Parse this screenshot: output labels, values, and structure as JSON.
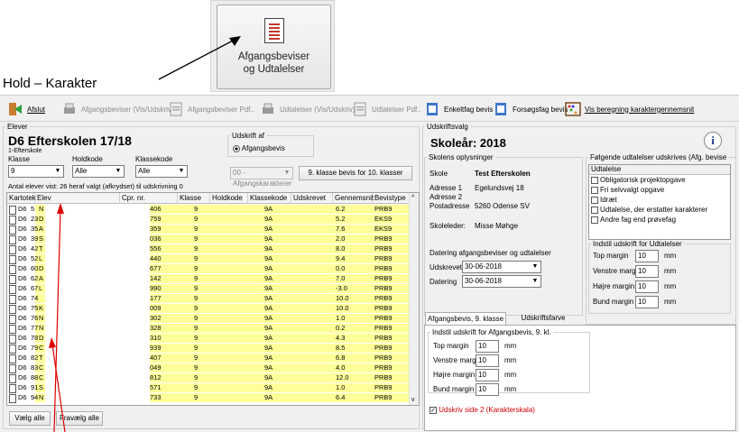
{
  "callout": {
    "button_line1": "Afgangsbeviser",
    "button_line2": "og Udtalelser"
  },
  "page_label": "Hold – Karakter",
  "toolbar": {
    "afslut": "Afslut",
    "afgangsbeviser_vis": "Afgangsbeviser (Vis/Udskriv)",
    "afgangsbeviser_pdf": "Afgangsbeviser Pdf..",
    "udtalelser_vis": "Udtalelser (Vis/Udskriv)",
    "udtalelser_pdf": "Udtalelser Pdf..",
    "enkeltfag": "Enkeltfag bevis",
    "fagsfag": "Forsøgsfag bevis",
    "vis_beregning": "Vis beregning karaktergennemsnit"
  },
  "elever": {
    "group_label": "Elever",
    "school_title": "D6 Efterskolen 17/18",
    "school_sub": "1-Efterskole",
    "klasse_label": "Klasse",
    "klasse_value": "9",
    "holdkode_label": "Holdkode",
    "holdkode_value": "Alle",
    "klassekode_label": "Klassekode",
    "klassekode_value": "Alle",
    "udskrift_af_label": "Udskrift af",
    "udskrift_af_option": "Afgangsbevis",
    "karakterer_combo": "00 - Afgangskarakterer",
    "button_9_klasse": "9. klasse bevis for 10. klasser",
    "antal_text": "Antal elever vist: 26 heraf valgt (afkrydset) til udskrivning 0",
    "columns": [
      "Kartotek",
      "Elev",
      "Cpr. nr.",
      "Klasse",
      "Holdkode",
      "Klassekode",
      "Udskrevet",
      "Gennemsnit",
      "Bevistype"
    ],
    "rows": [
      {
        "k1": "D6",
        "k2": "5",
        "e": "N",
        "cpr": "406",
        "kl": "9",
        "kk": "9A",
        "g": "6.2",
        "b": "PRB9"
      },
      {
        "k1": "D6",
        "k2": "23",
        "e": "D",
        "cpr": "759",
        "kl": "9",
        "kk": "9A",
        "g": "5.2",
        "b": "EKS9"
      },
      {
        "k1": "D6",
        "k2": "35",
        "e": "A",
        "cpr": "359",
        "kl": "9",
        "kk": "9A",
        "g": "7.6",
        "b": "EKS9"
      },
      {
        "k1": "D6",
        "k2": "39",
        "e": "S",
        "cpr": "036",
        "kl": "9",
        "kk": "9A",
        "g": "2.0",
        "b": "PRB9"
      },
      {
        "k1": "D6",
        "k2": "42",
        "e": "T",
        "cpr": "556",
        "kl": "9",
        "kk": "9A",
        "g": "8.0",
        "b": "PRB9"
      },
      {
        "k1": "D6",
        "k2": "52",
        "e": "L",
        "cpr": "440",
        "kl": "9",
        "kk": "9A",
        "g": "9.4",
        "b": "PRB9"
      },
      {
        "k1": "D6",
        "k2": "60",
        "e": "D",
        "cpr": "677",
        "kl": "9",
        "kk": "9A",
        "g": "0.0",
        "b": "PRB9"
      },
      {
        "k1": "D6",
        "k2": "62",
        "e": "A",
        "cpr": "142",
        "kl": "9",
        "kk": "9A",
        "g": "7.0",
        "b": "PRB9"
      },
      {
        "k1": "D6",
        "k2": "67",
        "e": "L",
        "cpr": "990",
        "kl": "9",
        "kk": "9A",
        "g": "-3.0",
        "b": "PRB9"
      },
      {
        "k1": "D6",
        "k2": "74",
        "e": "",
        "cpr": "177",
        "kl": "9",
        "kk": "9A",
        "g": "10.0",
        "b": "PRB9"
      },
      {
        "k1": "D6",
        "k2": "75",
        "e": "K",
        "cpr": "009",
        "kl": "9",
        "kk": "9A",
        "g": "10.0",
        "b": "PRB9"
      },
      {
        "k1": "D6",
        "k2": "76",
        "e": "N",
        "cpr": "302",
        "kl": "9",
        "kk": "9A",
        "g": "1.0",
        "b": "PRB9"
      },
      {
        "k1": "D6",
        "k2": "77",
        "e": "N",
        "cpr": "328",
        "kl": "9",
        "kk": "9A",
        "g": "0.2",
        "b": "PRB9"
      },
      {
        "k1": "D6",
        "k2": "78",
        "e": "D",
        "cpr": "310",
        "kl": "9",
        "kk": "9A",
        "g": "4.3",
        "b": "PRB9"
      },
      {
        "k1": "D6",
        "k2": "79",
        "e": "C",
        "cpr": "939",
        "kl": "9",
        "kk": "9A",
        "g": "8.5",
        "b": "PRB9"
      },
      {
        "k1": "D6",
        "k2": "82",
        "e": "T",
        "cpr": "407",
        "kl": "9",
        "kk": "9A",
        "g": "6.8",
        "b": "PRB9"
      },
      {
        "k1": "D6",
        "k2": "83",
        "e": "C",
        "cpr": "049",
        "kl": "9",
        "kk": "9A",
        "g": "4.0",
        "b": "PRB9"
      },
      {
        "k1": "D6",
        "k2": "88",
        "e": "C",
        "cpr": "812",
        "kl": "9",
        "kk": "9A",
        "g": "12.0",
        "b": "PRB9"
      },
      {
        "k1": "D6",
        "k2": "91",
        "e": "S",
        "cpr": "571",
        "kl": "9",
        "kk": "9A",
        "g": "1.0",
        "b": "PRB9"
      },
      {
        "k1": "D6",
        "k2": "94",
        "e": "N",
        "cpr": "733",
        "kl": "9",
        "kk": "9A",
        "g": "6.4",
        "b": "PRB9"
      }
    ],
    "vaelg_alle": "Vælg alle",
    "fravaelg_alle": "Fravælg alle"
  },
  "udskriftsvalg": {
    "group_label": "Udskriftsvalg",
    "skolear": "Skoleår: 2018",
    "skolens_label": "Skolens oplysninger",
    "skole_label": "Skole",
    "skole_value": "Test Efterskolen",
    "adresse1_label": "Adresse 1",
    "adresse1_value": "Egelundsvej 18",
    "adresse2_label": "Adresse 2",
    "postadresse_label": "Postadresse",
    "postadresse_value": "5260 Odense SV",
    "skoleleder_label": "Skoleleder:",
    "skoleleder_value": "Misse Møhge",
    "datering_label": "Datering afgangsbeviser og udtalelser",
    "udskrevet_label": "Udskrevet",
    "udskrevet_value": "30-06-2018",
    "datering_field_label": "Datering",
    "datering_value": "30-06-2018",
    "folgende_label": "Følgende udtalelser udskrives (Afg. bevise",
    "udtalelse_header": "Udtalelse",
    "udtalelser": [
      "Obligatorisk projektopgave",
      "Fri selvvalgt opgave",
      "Idræt",
      "Udtalelse, der erstatter karakterer",
      "Andre fag end prøvefag"
    ],
    "indstil_udt_label": "Indstil udskrift for Udtalelser",
    "top_margin": "Top margin",
    "venstre_margin": "Venstre margin",
    "hojre_margin": "Højre margin",
    "bund_margin": "Bund margin",
    "margin_value": "10",
    "mm": "mm",
    "tab_afgangsbevis": "Afgangsbevis, 9. klasse",
    "tab_udskriftsfarve": "Udskriftsfarve",
    "indstil_afg_label": "Indstil udskrift for Afgangsbevis, 9. kl.",
    "udskriv_side2": "Udskriv side 2 (Karakterskala)"
  }
}
